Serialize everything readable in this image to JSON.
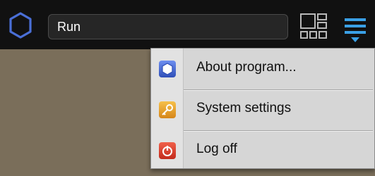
{
  "topbar": {
    "run_field": {
      "value": "Run"
    },
    "colors": {
      "accent": "#3aa0e6",
      "logo_stroke": "#4a6fd6",
      "bar_bg": "#111111",
      "desktop_bg": "#7a6e5a"
    }
  },
  "menu": {
    "items": [
      {
        "label": "About program...",
        "icon": "hexagon-icon"
      },
      {
        "label": "System settings",
        "icon": "key-icon"
      },
      {
        "label": "Log off",
        "icon": "power-icon"
      }
    ]
  }
}
